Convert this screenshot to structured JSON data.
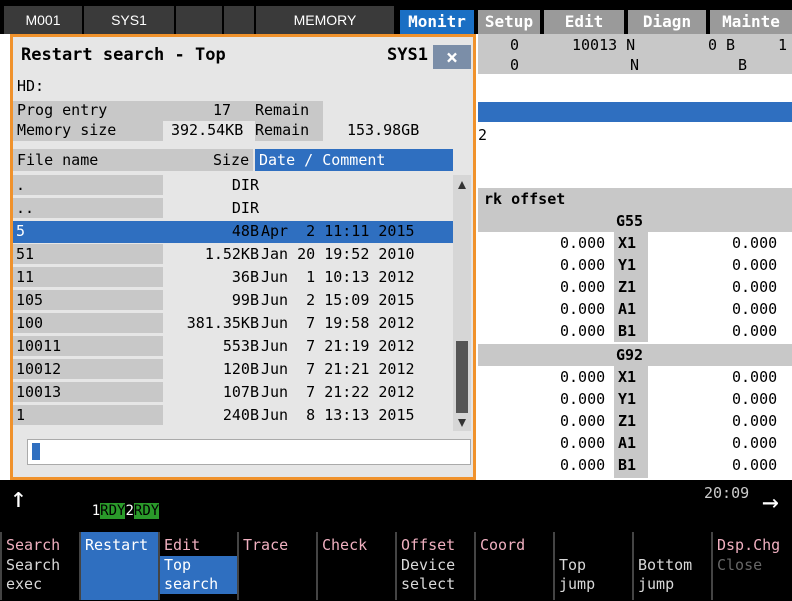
{
  "top_bar": {
    "cells": [
      "M001",
      "SYS1",
      "",
      "",
      "MEMORY"
    ],
    "tabs": [
      "Monitr",
      "Setup",
      "Edit",
      "Diagn",
      "Mainte"
    ]
  },
  "background": {
    "row1": [
      "0",
      "10013 N",
      "0 B",
      "1"
    ],
    "row2": [
      "0",
      "N",
      "B"
    ],
    "num2": "2",
    "offset_title": "rk offset",
    "g55": "G55",
    "g92": "G92",
    "g55_left": [
      "0.000",
      "0.000",
      "0.000",
      "0.000",
      "0.000"
    ],
    "g55_axes": [
      "X1",
      "Y1",
      "Z1",
      "A1",
      "B1"
    ],
    "g55_right": [
      "0.000",
      "0.000",
      "0.000",
      "0.000",
      "0.000"
    ],
    "g92_left": [
      "0.000",
      "0.000",
      "0.000",
      "0.000",
      "0.000"
    ],
    "g92_axes": [
      "X1",
      "Y1",
      "Z1",
      "A1",
      "B1"
    ],
    "g92_right": [
      "0.000",
      "0.000",
      "0.000",
      "0.000",
      "0.000"
    ]
  },
  "popup": {
    "title": "Restart search - Top",
    "sys": "SYS1",
    "close_symbol": "×",
    "hd": "HD:",
    "prog_entry_label": "Prog entry",
    "prog_entry_value": "17",
    "remain1_label": "Remain",
    "memory_size_label": "Memory size",
    "memory_size_value": "392.54KB",
    "remain2_label": "Remain",
    "remain2_value": "153.98GB",
    "col_name": "File name",
    "col_size": "Size",
    "col_date": "Date / Comment",
    "files": [
      {
        "name": ".",
        "size": "DIR",
        "date": ""
      },
      {
        "name": "..",
        "size": "DIR",
        "date": ""
      },
      {
        "name": "5",
        "size": "48B",
        "date": "Apr  2 11:11 2015"
      },
      {
        "name": "51",
        "size": "1.52KB",
        "date": "Jan 20 19:52 2010"
      },
      {
        "name": "11",
        "size": "36B",
        "date": "Jun  1 10:13 2012"
      },
      {
        "name": "105",
        "size": "99B",
        "date": "Jun  2 15:09 2015"
      },
      {
        "name": "100",
        "size": "381.35KB",
        "date": "Jun  7 19:58 2012"
      },
      {
        "name": "10011",
        "size": "553B",
        "date": "Jun  7 21:19 2012"
      },
      {
        "name": "10012",
        "size": "120B",
        "date": "Jun  7 21:21 2012"
      },
      {
        "name": "10013",
        "size": "107B",
        "date": "Jun  7 21:22 2012"
      },
      {
        "name": "1",
        "size": "240B",
        "date": "Jun  8 13:13 2015"
      }
    ]
  },
  "status": {
    "rdy1_num": "1",
    "rdy1": "RDY",
    "rdy2_num": "2",
    "rdy2": "RDY",
    "time": "20:09"
  },
  "softkeys": [
    {
      "top": "Search",
      "bottom": "Search\nexec"
    },
    {
      "top": "Restart",
      "bottom": ""
    },
    {
      "top": "Edit",
      "bottom": "Top\nsearch"
    },
    {
      "top": "Trace",
      "bottom": ""
    },
    {
      "top": "Check",
      "bottom": ""
    },
    {
      "top": "Offset",
      "bottom": "Device\nselect"
    },
    {
      "top": "Coord",
      "bottom": ""
    },
    {
      "top": "",
      "bottom": "Top\njump"
    },
    {
      "top": "",
      "bottom": "Bottom\njump"
    },
    {
      "top": "Dsp.Chg",
      "bottom": "Close"
    }
  ]
}
